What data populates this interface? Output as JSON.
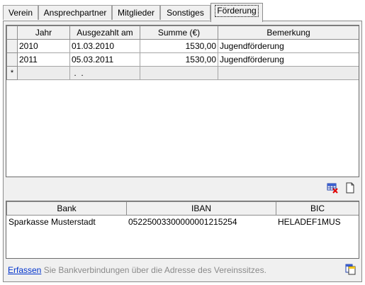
{
  "tabs": [
    {
      "label": "Verein"
    },
    {
      "label": "Ansprechpartner"
    },
    {
      "label": "Mitglieder"
    },
    {
      "label": "Sonstiges"
    },
    {
      "label": "Förderung"
    }
  ],
  "funding_grid": {
    "columns": [
      "Jahr",
      "Ausgezahlt am",
      "Summe (€)",
      "Bemerkung"
    ],
    "rows": [
      {
        "jahr": "2010",
        "datum": "01.03.2010",
        "summe": "1530,00",
        "bemerkung": "Jugendförderung"
      },
      {
        "jahr": "2011",
        "datum": "05.03.2011",
        "summe": "1530,00",
        "bemerkung": "Jugendförderung"
      }
    ],
    "new_row": {
      "marker": "*",
      "datum": " .  ."
    }
  },
  "bank_grid": {
    "columns": [
      "Bank",
      "IBAN",
      "BIC"
    ],
    "rows": [
      {
        "bank": "Sparkasse Musterstadt",
        "iban": "05225003300000001215254",
        "bic": "HELADEF1MUS"
      }
    ]
  },
  "footer": {
    "link_label": "Erfassen",
    "hint_text": "Sie Bankverbindungen über die Adresse des Vereinssitzes."
  },
  "icons": {
    "delete_row": "grid-delete-icon",
    "new_document": "new-document-icon",
    "copy": "copy-icon"
  }
}
